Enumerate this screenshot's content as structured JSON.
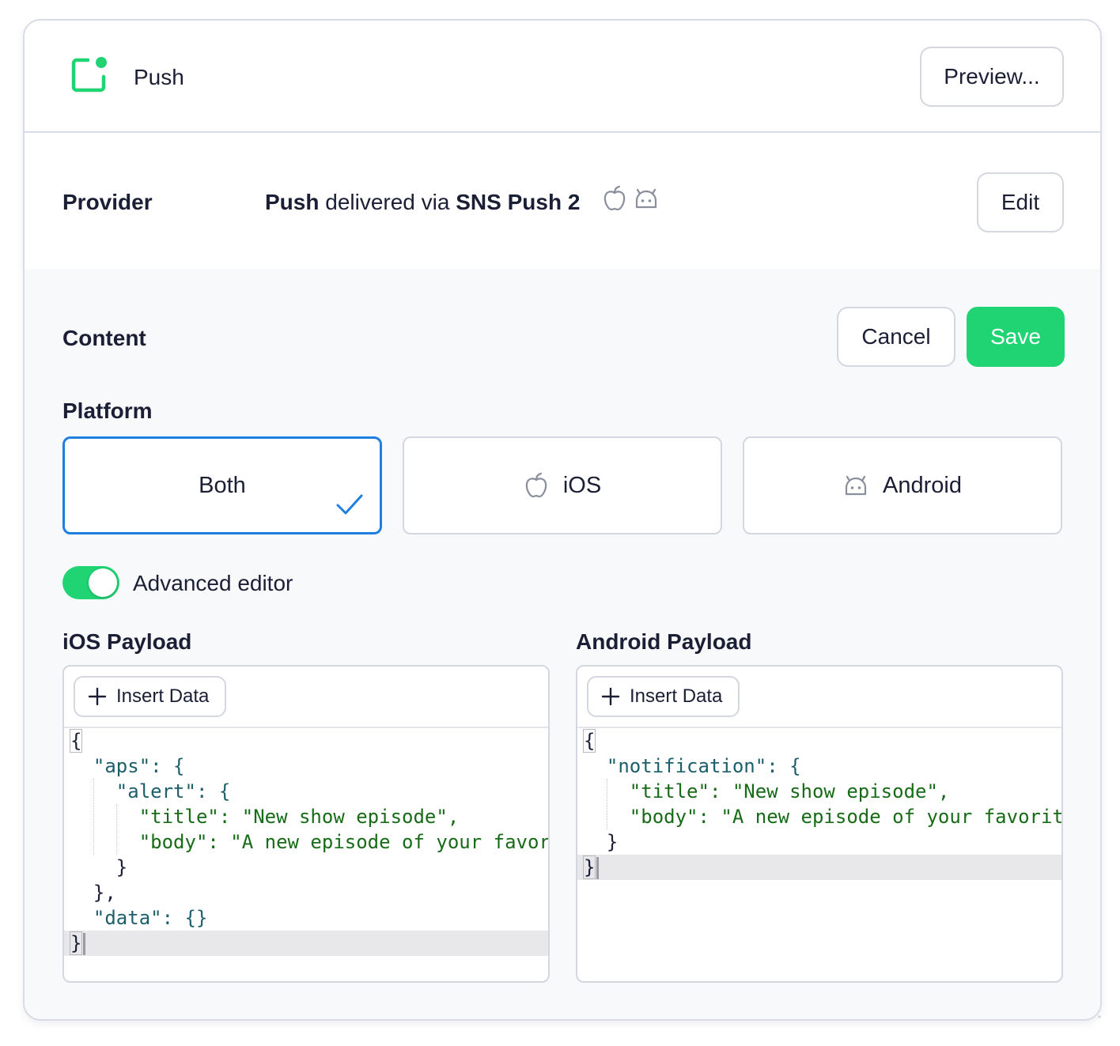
{
  "header": {
    "title": "Push",
    "preview_label": "Preview..."
  },
  "provider": {
    "label": "Provider",
    "prefix": "Push",
    "middle": " delivered via ",
    "name": "SNS Push 2",
    "edit_label": "Edit"
  },
  "content": {
    "label": "Content",
    "cancel_label": "Cancel",
    "save_label": "Save",
    "platform_label": "Platform",
    "platforms": [
      {
        "label": "Both",
        "selected": true
      },
      {
        "label": "iOS",
        "selected": false
      },
      {
        "label": "Android",
        "selected": false
      }
    ],
    "advanced_editor_label": "Advanced editor",
    "advanced_editor_on": true
  },
  "ios_payload": {
    "label": "iOS Payload",
    "insert_label": "Insert Data",
    "lines": [
      "{",
      "  \"aps\": {",
      "    \"alert\": {",
      "      \"title\": \"New show episode\",",
      "      \"body\": \"A new episode of your favor",
      "    }",
      "  },",
      "  \"data\": {}",
      "}"
    ]
  },
  "android_payload": {
    "label": "Android Payload",
    "insert_label": "Insert Data",
    "lines": [
      "{",
      "  \"notification\": {",
      "    \"title\": \"New show episode\",",
      "    \"body\": \"A new episode of your favorit",
      "  }",
      "}"
    ]
  },
  "colors": {
    "accent_green": "#20d474",
    "selected_blue": "#1f7fe0",
    "text": "#1b1f35"
  }
}
